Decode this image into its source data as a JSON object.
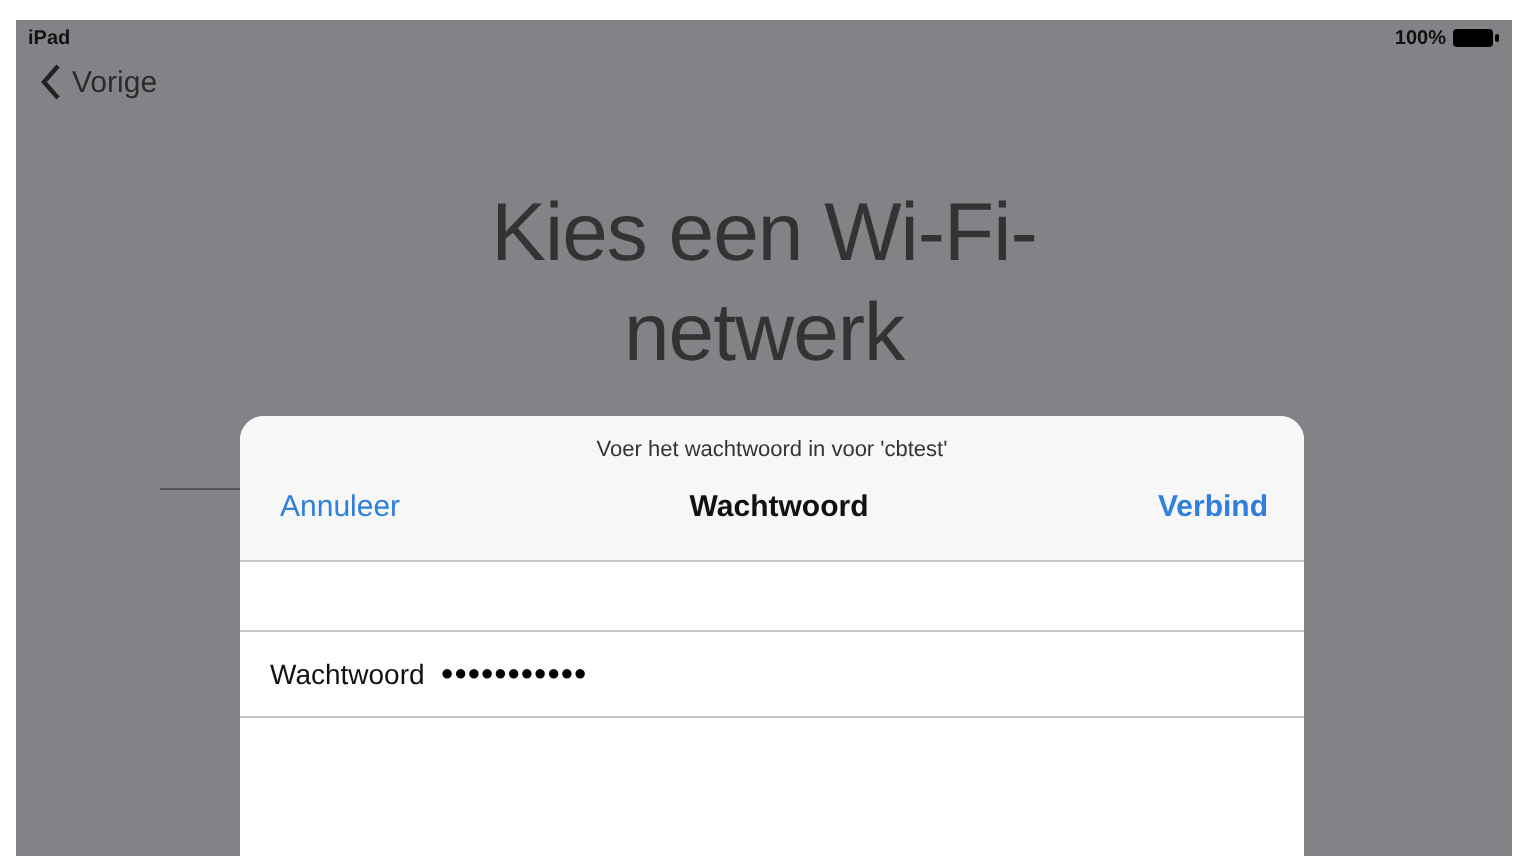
{
  "status_bar": {
    "device": "iPad",
    "battery": "100%"
  },
  "nav": {
    "back": "Vorige"
  },
  "title_lines": [
    "Kies een Wi-Fi-",
    "netwerk"
  ],
  "dialog": {
    "prompt": "Voer het wachtwoord in voor 'cbtest'",
    "cancel": "Annuleer",
    "title": "Wachtwoord",
    "confirm": "Verbind",
    "password": {
      "label": "Wachtwoord",
      "value": "●●●●●●●●●●●"
    }
  }
}
